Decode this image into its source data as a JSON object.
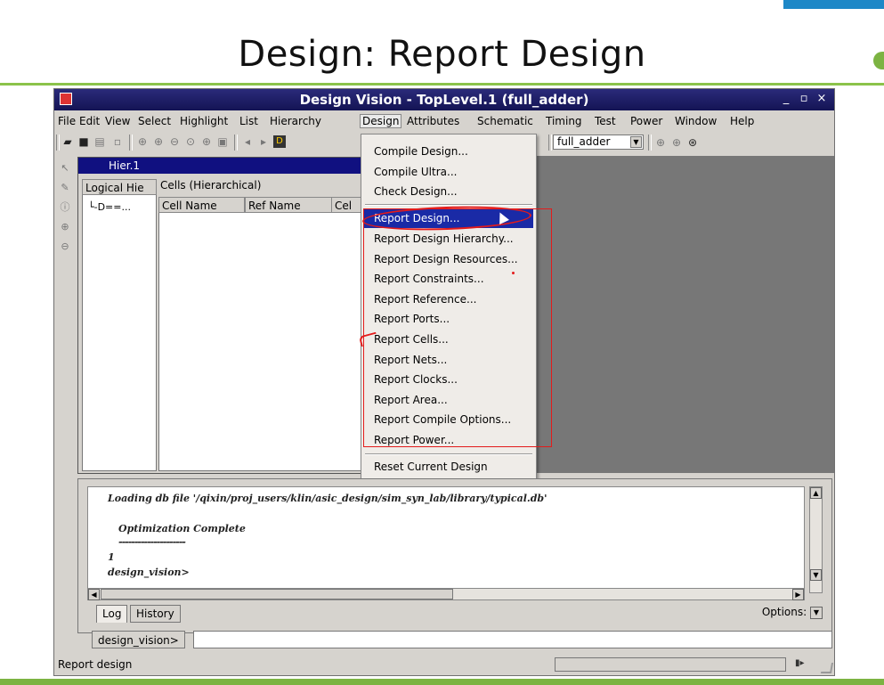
{
  "slide": {
    "title": "Design: Report Design"
  },
  "window": {
    "title": "Design Vision - TopLevel.1 (full_adder)",
    "controls": [
      "_",
      "▫",
      "×"
    ]
  },
  "menubar": [
    "File",
    "Edit",
    "View",
    "Select",
    "Highlight",
    "List",
    "Hierarchy",
    "Design",
    "Attributes",
    "Schematic",
    "Timing",
    "Test",
    "Power",
    "Window",
    "Help"
  ],
  "toolbar": {
    "design_combo": "full_adder"
  },
  "hier_panel": {
    "title": "Hier.1",
    "logical_header": "Logical Hie",
    "cells_label": "Cells (Hierarchical)",
    "columns": [
      "Cell Name",
      "Ref Name",
      "Cel"
    ],
    "tree_node": "└-D==..."
  },
  "design_menu": {
    "group1": [
      "Compile Design...",
      "Compile Ultra...",
      "Check Design..."
    ],
    "report_items": [
      "Report Design...",
      "Report Design Hierarchy...",
      "Report Design Resources...",
      "Report Constraints...",
      "Report Reference...",
      "Report Ports...",
      "Report Cells...",
      "Report Nets...",
      "Report Clocks...",
      "Report Area...",
      "Report Compile Options...",
      "Report Power..."
    ],
    "group3": [
      "Reset Current Design"
    ],
    "selected": "Report Design..."
  },
  "log": {
    "lines": [
      "Loading db file '/qixin/proj_users/klin/asic_design/sim_syn_lab/library/typical.db'",
      "Optimization Complete",
      "---------------------",
      "1",
      "design_vision>"
    ],
    "tabs": [
      "Log",
      "History"
    ],
    "options_label": "Options:"
  },
  "command": {
    "prompt": "design_vision>",
    "value": ""
  },
  "status": {
    "text": "Report design"
  },
  "colors": {
    "accent_blue": "#1e88c7",
    "slide_green": "#8bc34a",
    "title_bar": "#141454",
    "menu_highlight": "#1a2aa6",
    "annotation_red": "#e31b1b",
    "canvas_grey": "#777777"
  }
}
